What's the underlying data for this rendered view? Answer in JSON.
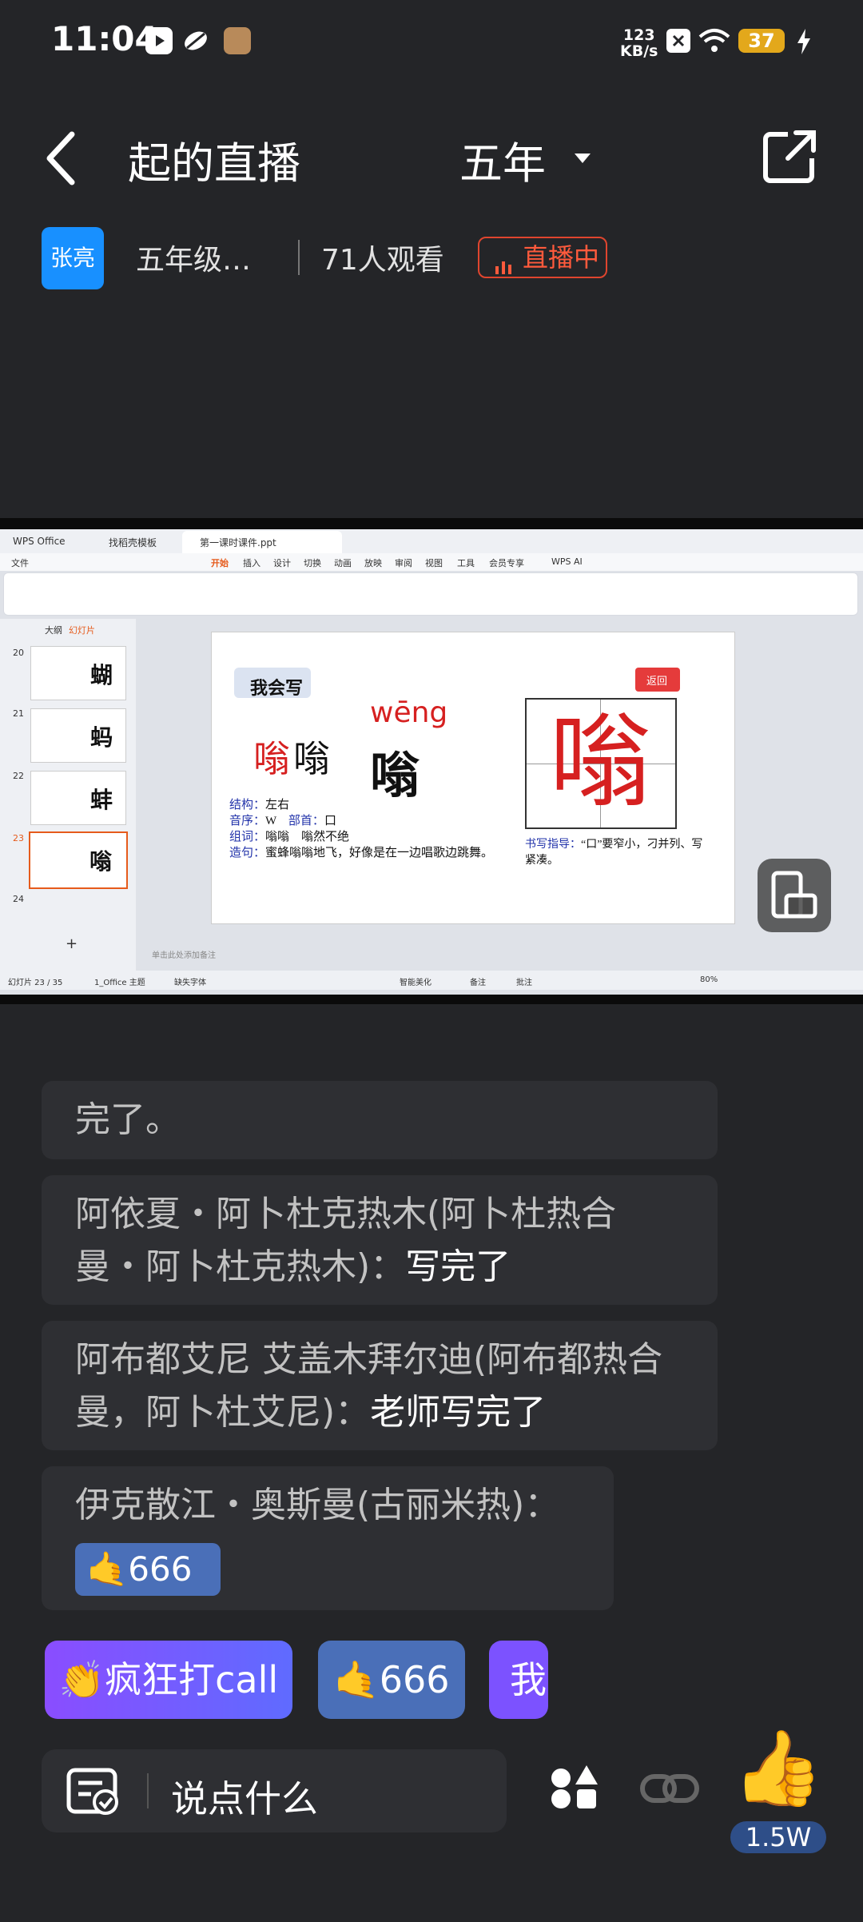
{
  "status_bar": {
    "time": "11:04",
    "net_speed_value": "123",
    "net_speed_unit": "KB/s",
    "battery": "37"
  },
  "header": {
    "title_left": "起的直播",
    "title_right": "五年",
    "host_name": "张亮",
    "class_name": "五年级…",
    "viewers": "71人观看",
    "live_label": "直播中"
  },
  "slide": {
    "app_tab1": "WPS Office",
    "app_tab2": "找稻壳模板",
    "app_tab3": "第一课时课件.ppt",
    "menu": [
      "文件",
      "开始",
      "插入",
      "设计",
      "切换",
      "动画",
      "放映",
      "审阅",
      "视图",
      "工具",
      "会员专享",
      "WPS AI"
    ],
    "panel_tabs": [
      "大纲",
      "幻灯片"
    ],
    "thumb_numbers": [
      "20",
      "21",
      "22",
      "23",
      "24"
    ],
    "thumb_chars": [
      "蝴",
      "蚂",
      "蚌",
      "嗡"
    ],
    "heading": "我会写",
    "back_label": "返回",
    "pinyin": "wēng",
    "char_red": "嗡",
    "char_outline": "嗡",
    "char_big": "嗡",
    "char_grid": "嗡",
    "line1_label": "结构：",
    "line1_value": "左右",
    "line2_label": "音序：",
    "line2_value": "W",
    "line2_label2": "部首：",
    "line2_value2": "口",
    "line3_label": "组词：",
    "line3_value": "嗡嗡　嗡然不绝",
    "line4_label": "造句：",
    "line4_value": "蜜蜂嗡嗡地飞，好像是在一边唱歌边跳舞。",
    "guide_label": "书写指导：",
    "guide_value": "“口”要窄小，刁并列、写紧凑。",
    "notes": "单击此处添加备注",
    "status_left": "幻灯片 23 / 35",
    "theme": "1_Office 主题",
    "font_missing": "缺失字体",
    "zoom": "80%",
    "beautify": "智能美化",
    "remark": "备注",
    "comment": "批注"
  },
  "chat": [
    {
      "name": "",
      "text": "完了。"
    },
    {
      "name": "阿依夏・阿卜杜克热木(阿卜杜热合曼・阿卜杜克热木)：",
      "text": "写完了"
    },
    {
      "name": "阿布都艾尼 艾盖木拜尔迪(阿布都热合曼，阿卜杜艾尼)：",
      "text": "老师写完了"
    },
    {
      "name": "伊克散江・奥斯曼(古丽米热)：",
      "text": "666"
    }
  ],
  "chips": [
    "疯狂打call",
    "666",
    "我"
  ],
  "input": {
    "placeholder": "说点什么"
  },
  "likes": "1.5W",
  "colors": {
    "accent_live": "#e0452e",
    "avatar_blue": "#1890ff",
    "chip_purple": "#8a4dff",
    "chip_blue": "#4a6fb8"
  }
}
